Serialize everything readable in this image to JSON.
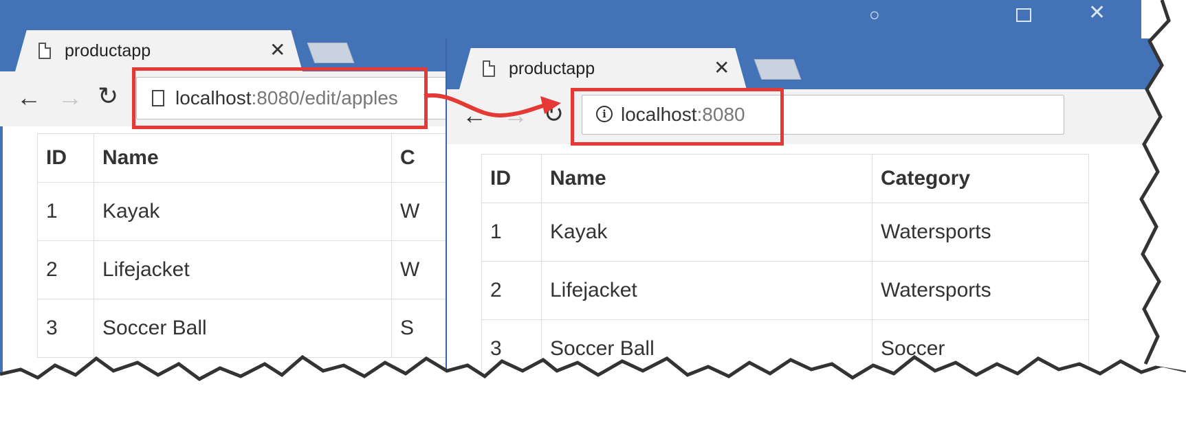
{
  "back_window": {
    "tab_title": "productapp",
    "url_host": "localhost",
    "url_rest": ":8080/edit/apples",
    "table": {
      "headers": [
        "ID",
        "Name",
        "C"
      ],
      "rows": [
        [
          "1",
          "Kayak",
          "W"
        ],
        [
          "2",
          "Lifejacket",
          "W"
        ],
        [
          "3",
          "Soccer Ball",
          "S"
        ]
      ]
    }
  },
  "front_window": {
    "tab_title": "productapp",
    "url_host": "localhost",
    "url_rest": ":8080",
    "table": {
      "headers": [
        "ID",
        "Name",
        "Category"
      ],
      "rows": [
        [
          "1",
          "Kayak",
          "Watersports"
        ],
        [
          "2",
          "Lifejacket",
          "Watersports"
        ],
        [
          "3",
          "Soccer Ball",
          "Soccer"
        ]
      ]
    }
  },
  "colors": {
    "titlebar": "#4472b7",
    "highlight": "#e53935"
  },
  "icons": {
    "page": "page-icon",
    "info": "info-icon",
    "back": "back-arrow-icon",
    "forward": "forward-arrow-icon",
    "reload": "reload-icon",
    "close": "close-icon"
  }
}
